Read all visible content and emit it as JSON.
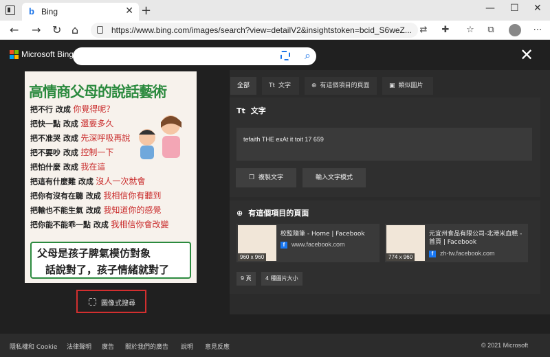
{
  "browser": {
    "tab_title": "Bing",
    "url": "https://www.bing.com/images/search?view=detailV2&insightstoken=bcid_S6weZ..."
  },
  "bing": {
    "logo_text": "Microsoft Bing",
    "search_value": ""
  },
  "image": {
    "headline": "高情商父母的說話藝術",
    "rows": [
      {
        "a": "把不行 改成",
        "b": "你覺得呢？"
      },
      {
        "a": "把快一點 改成",
        "b": "還要多久"
      },
      {
        "a": "把不准哭 改成",
        "b": "先深呼吸再說"
      },
      {
        "a": "把不要吵 改成",
        "b": "控制一下"
      },
      {
        "a": "把怕什麼 改成",
        "b": "我在這"
      },
      {
        "a": "把這有什麼難 改成",
        "b": "沒人一次就會"
      },
      {
        "a": "把你有沒有在聽 改成",
        "b": "我相信你有聽到"
      },
      {
        "a": "把輸也不能生氣 改成",
        "b": "我知道你的感覺"
      },
      {
        "a": "把你能不能乖一點 改成",
        "b": "我相信你會改變"
      }
    ],
    "bottom1": "父母是孩子脾氣模仿對象",
    "bottom2": "話說對了，孩子情緒就對了"
  },
  "visual_search_label": "圖像式搜尋",
  "tabs": [
    {
      "label": "全部",
      "icon": ""
    },
    {
      "label": "文字",
      "icon": "Tt"
    },
    {
      "label": "有這個項目的頁面",
      "icon": "⊕"
    },
    {
      "label": "類似圖片",
      "icon": "▣"
    }
  ],
  "text_section": {
    "title": "文字",
    "icon": "Tt",
    "ocr": "tefaith THE exAt it toit 17 659",
    "copy_button": "複製文字",
    "text_mode_button": "輸入文字模式"
  },
  "pages_section": {
    "title": "有這個項目的頁面",
    "items": [
      {
        "title": "校監隨筆 - Home | Facebook",
        "domain": "www.facebook.com",
        "dims": "960 x 960"
      },
      {
        "title": "元宜州食品有限公司-北港米血糕 - 首頁 | Facebook",
        "domain": "zh-tw.facebook.com",
        "dims": "774 x 960"
      }
    ],
    "chips": [
      "9 頁",
      "4 種圖片大小"
    ]
  },
  "footer": {
    "links": [
      "隱私權和 Cookie",
      "法律聲明",
      "廣告",
      "關於我們的廣告",
      "說明",
      "意見反應"
    ],
    "copyright": "© 2021 Microsoft"
  }
}
